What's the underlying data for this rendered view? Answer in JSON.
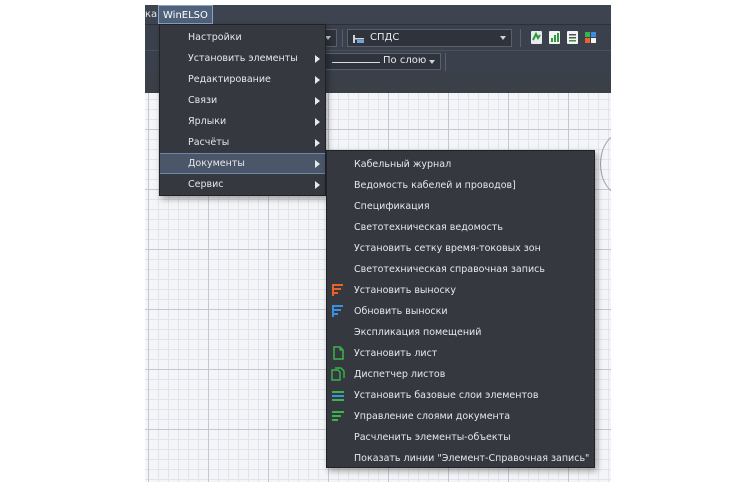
{
  "menubar": {
    "prev_label": "ка",
    "winelso_label": "WinELSO"
  },
  "toolbar": {
    "style_combo": "СПДС",
    "linetype_combo": "По слою"
  },
  "main_menu": {
    "items": [
      {
        "label": "Настройки",
        "submenu": false,
        "highlighted": false
      },
      {
        "label": "Установить элементы",
        "submenu": true,
        "highlighted": false
      },
      {
        "label": "Редактирование",
        "submenu": true,
        "highlighted": false
      },
      {
        "label": "Связи",
        "submenu": true,
        "highlighted": false
      },
      {
        "label": "Ярлыки",
        "submenu": true,
        "highlighted": false
      },
      {
        "label": "Расчёты",
        "submenu": true,
        "highlighted": false
      },
      {
        "label": "Документы",
        "submenu": true,
        "highlighted": true
      },
      {
        "label": "Сервис",
        "submenu": true,
        "highlighted": false
      }
    ]
  },
  "documents_submenu": {
    "items": [
      {
        "label": "Кабельный журнал",
        "icon": null
      },
      {
        "label": "Ведомость кабелей и проводов]",
        "icon": null
      },
      {
        "label": "Спецификация",
        "icon": null
      },
      {
        "label": "Светотехническая ведомость",
        "icon": null
      },
      {
        "label": "Установить сетку время-токовых зон",
        "icon": null
      },
      {
        "label": "Светотехническая справочная запись",
        "icon": null
      },
      {
        "label": "Установить выноску",
        "icon": "callout-orange-icon"
      },
      {
        "label": "Обновить выноски",
        "icon": "callout-blue-icon"
      },
      {
        "label": "Экспликация помещений",
        "icon": null
      },
      {
        "label": "Установить лист",
        "icon": "sheet-green-icon"
      },
      {
        "label": "Диспетчер листов",
        "icon": "sheets-manager-icon"
      },
      {
        "label": "Установить базовые слои элементов",
        "icon": "layers-base-icon"
      },
      {
        "label": "Управление слоями документа",
        "icon": "layers-manage-icon"
      },
      {
        "label": "Расчленить элементы-объекты",
        "icon": null
      },
      {
        "label": "Показать линии \"Элемент-Справочная запись\"",
        "icon": null
      }
    ]
  },
  "colors": {
    "menu_bg": "#35383e",
    "highlight_bg": "#4b5668",
    "highlight_border": "#6d86ab",
    "toolbar_bg": "#3b414c",
    "icon_orange": "#e8622a",
    "icon_blue": "#3b8fe0",
    "icon_green": "#3ab54a"
  }
}
